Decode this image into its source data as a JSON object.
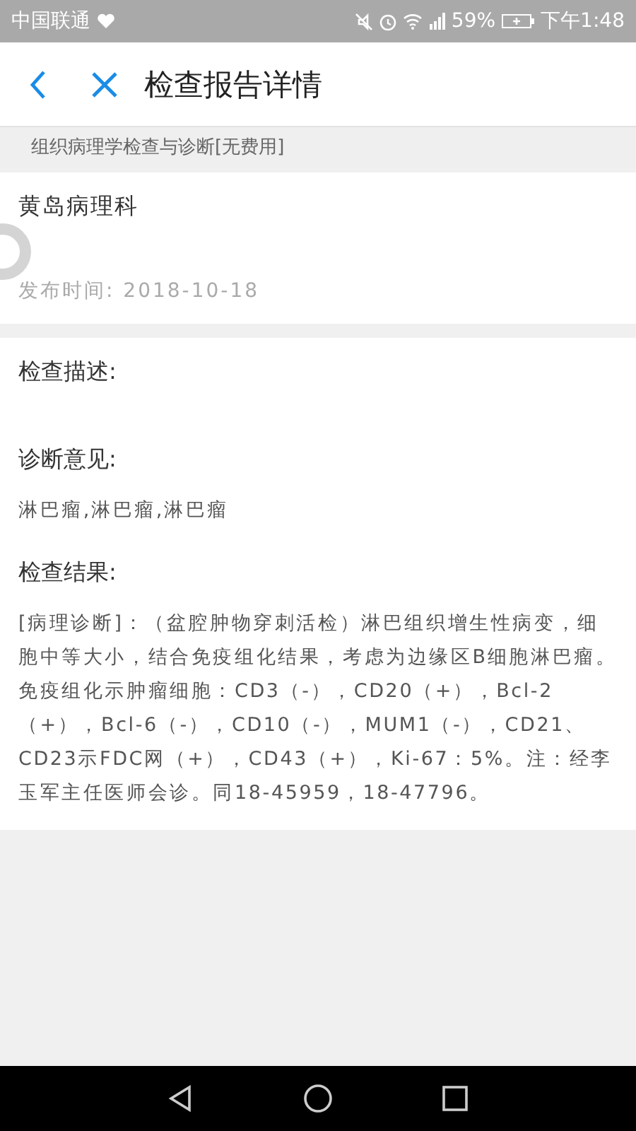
{
  "status_bar": {
    "carrier": "中国联通",
    "battery": "59%",
    "time": "下午1:48"
  },
  "header": {
    "title": "检查报告详情"
  },
  "subtitle": "组织病理学检查与诊断[无费用]",
  "report": {
    "department": "黄岛病理科",
    "published": "发布时间:  2018-10-18"
  },
  "sections": [
    {
      "heading": "检查描述:"
    },
    {
      "heading": "诊断意见:",
      "body": "淋巴瘤,淋巴瘤,淋巴瘤"
    },
    {
      "heading": "检查结果:",
      "body": "[病理诊断]：（盆腔肿物穿刺活检）淋巴组织增生性病变，细胞中等大小，结合免疫组化结果，考虑为边缘区B细胞淋巴瘤。免疫组化示肿瘤细胞：CD3（-），CD20（+），Bcl-2（+），Bcl-6（-），CD10（-），MUM1（-），CD21、CD23示FDC网（+），CD43（+），Ki-67：5%。注：经李玉军主任医师会诊。同18-45959，18-47796。"
    }
  ]
}
